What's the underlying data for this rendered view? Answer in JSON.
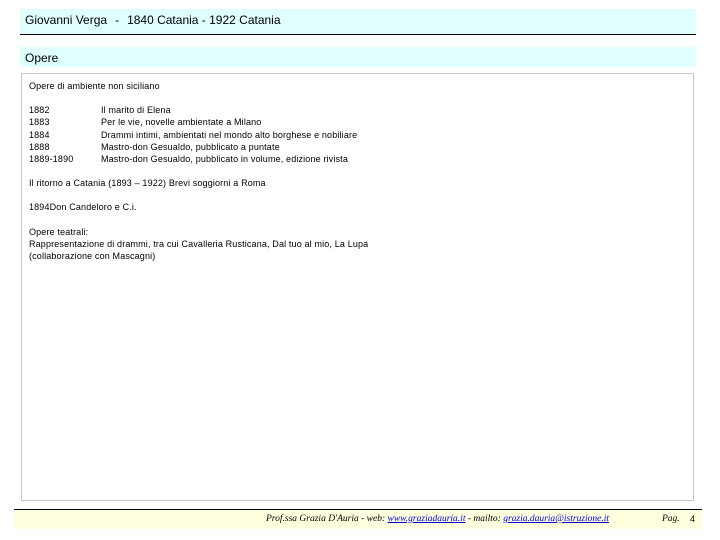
{
  "header": {
    "author": "Giovanni Verga",
    "separator": "-",
    "dates": "1840 Catania - 1922 Catania"
  },
  "section": {
    "title": "Opere"
  },
  "content": {
    "intro": "Opere di ambiente non siciliano",
    "works": [
      {
        "year": "1882",
        "title": "Il marito di Elena"
      },
      {
        "year": "1883",
        "title": "Per le vie, novelle ambientate a Milano"
      },
      {
        "year": "1884",
        "title": "Drammi intimi, ambientati nel mondo alto borghese e nobiliare"
      },
      {
        "year": "1888",
        "title": "Mastro-don Gesualdo, pubblicato a puntate"
      },
      {
        "year": "1889-1890",
        "title": "Mastro-don Gesualdo, pubblicato in volume, edizione rivista"
      }
    ],
    "return_text": "Il ritorno a Catania (1893 – 1922) Brevi soggiorni a Roma",
    "don_candeloro": "1894Don Candeloro e C.i.",
    "theatre_heading": "Opere teatrali:",
    "theatre_line1": "Rappresentazione di drammi, tra cui Cavalleria Rusticana, Dal tuo al mio, La Lupa",
    "theatre_line2": "(collaborazione con Mascagni)"
  },
  "footer": {
    "credit_prefix": "Prof.ssa Grazia D'Auria  -  web: ",
    "web_link": "www.graziadauria.it",
    "mail_prefix": " - mailto: ",
    "mail_link": "grazia.dauria@istruzione.it",
    "page_label": "Pag.",
    "page_number": "4"
  }
}
